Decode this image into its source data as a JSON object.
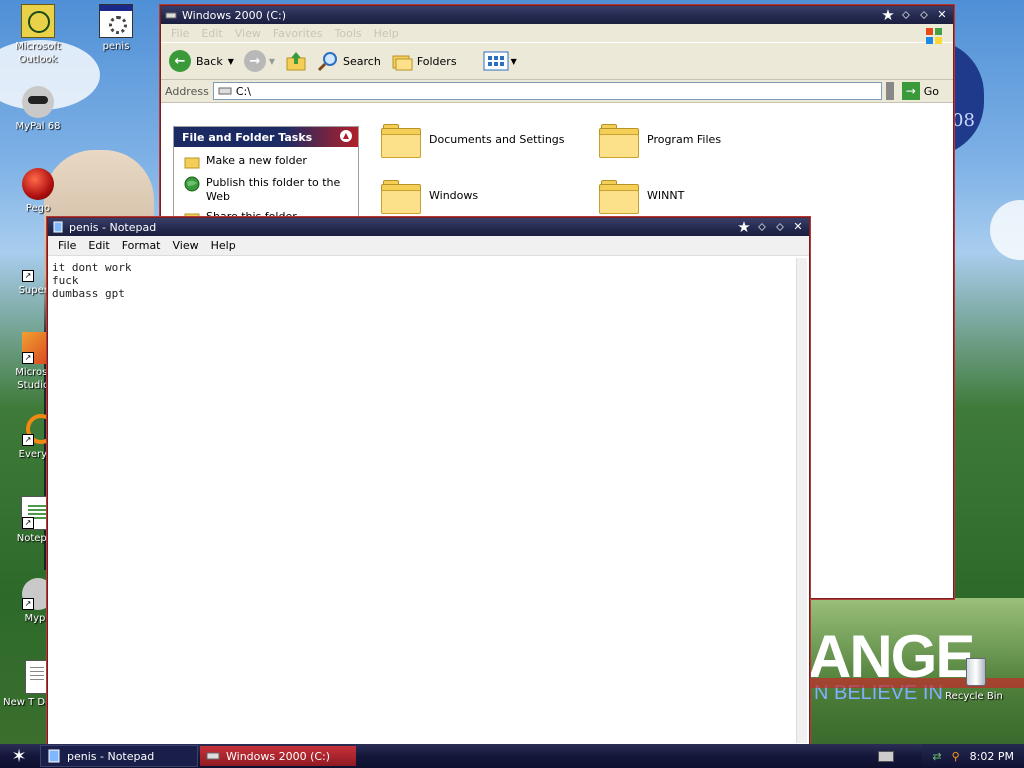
{
  "desktop": {
    "icons": [
      {
        "label": "Microsoft Outlook"
      },
      {
        "label": "penis"
      },
      {
        "label": "MyPal 68"
      },
      {
        "label": "Pego"
      },
      {
        "label": "Superm"
      },
      {
        "label": "Microsoft Studio 2"
      },
      {
        "label": "Everyth"
      },
      {
        "label": "Notepad"
      },
      {
        "label": "Mypa"
      },
      {
        "label": "New T Docum"
      },
      {
        "label": "Recycle Bin"
      }
    ],
    "wallpaper_text": {
      "headline": "ANGE",
      "tagline": "N BELIEVE IN",
      "badge": "08"
    }
  },
  "explorer": {
    "title": "Windows 2000 (C:)",
    "menu": [
      "File",
      "Edit",
      "View",
      "Favorites",
      "Tools",
      "Help"
    ],
    "toolbar": {
      "back": "Back",
      "search": "Search",
      "folders": "Folders"
    },
    "address": {
      "label": "Address",
      "value": "C:\\",
      "go": "Go"
    },
    "tasks": {
      "header": "File and Folder Tasks",
      "items": [
        {
          "label": "Make a new folder"
        },
        {
          "label": "Publish this folder to the Web"
        },
        {
          "label": "Share this folder"
        }
      ]
    },
    "folders": [
      {
        "name": "Documents and Settings"
      },
      {
        "name": "Program Files"
      },
      {
        "name": "Windows"
      },
      {
        "name": "WINNT"
      }
    ]
  },
  "notepad": {
    "title": "penis - Notepad",
    "menu": [
      "File",
      "Edit",
      "Format",
      "View",
      "Help"
    ],
    "lines": [
      "it dont work",
      "fuck",
      "dumbass gpt"
    ]
  },
  "taskbar": {
    "tasks": [
      {
        "label": "penis - Notepad"
      },
      {
        "label": "Windows 2000 (C:)"
      }
    ],
    "clock": "8:02 PM"
  },
  "colors": {
    "titlebar": "#23284d",
    "window_border": "#b23a3a",
    "taskbar": "#14173a",
    "chrome": "#ece9d8"
  }
}
